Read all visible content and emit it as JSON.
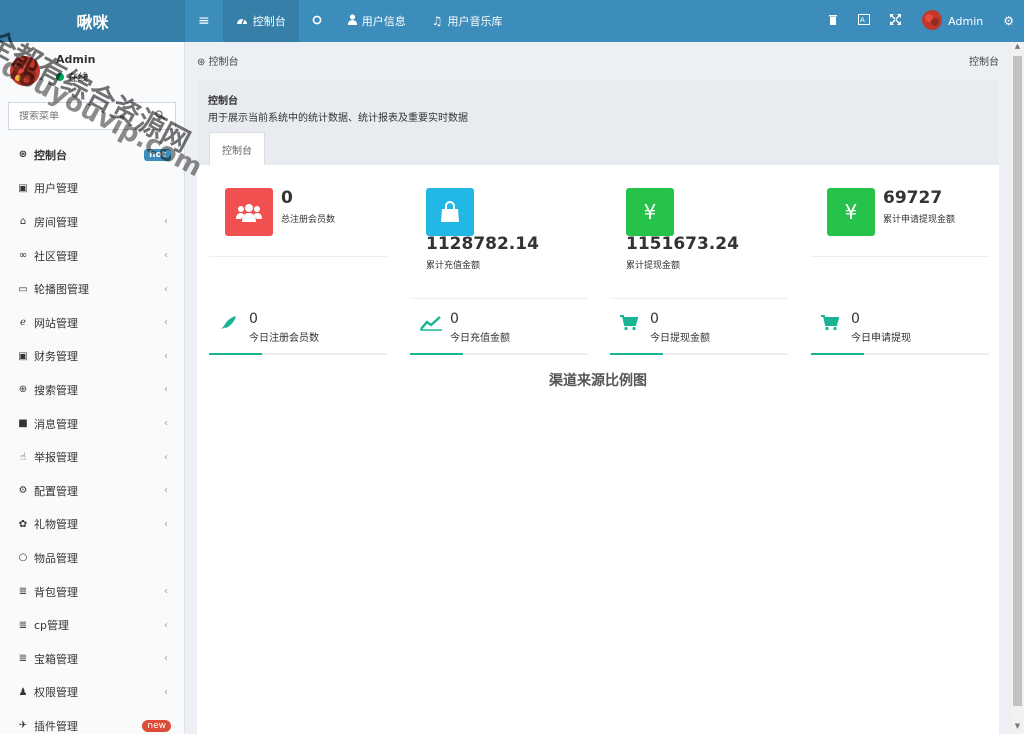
{
  "app": {
    "logo": "啾咪"
  },
  "topnav": {
    "menu_icon": "≡",
    "items": [
      {
        "label": "控制台",
        "icon": "dashboard-icon"
      },
      {
        "label": "",
        "icon": "circle-icon"
      },
      {
        "label": "用户信息",
        "icon": "user-icon"
      },
      {
        "label": "用户音乐库",
        "icon": "music-icon"
      }
    ],
    "right": {
      "admin_name": "Admin"
    }
  },
  "sidebar": {
    "user": {
      "name": "Admin",
      "status": "在线"
    },
    "search_placeholder": "搜索菜单",
    "items": [
      {
        "label": "控制台",
        "icon": "⊛",
        "badge": "hot"
      },
      {
        "label": "用户管理",
        "icon": "▣"
      },
      {
        "label": "房间管理",
        "icon": "⌂"
      },
      {
        "label": "社区管理",
        "icon": "∞"
      },
      {
        "label": "轮播图管理",
        "icon": "▭"
      },
      {
        "label": "网站管理",
        "icon": "ℯ"
      },
      {
        "label": "财务管理",
        "icon": "▣"
      },
      {
        "label": "搜索管理",
        "icon": "⊕"
      },
      {
        "label": "消息管理",
        "icon": "■"
      },
      {
        "label": "举报管理",
        "icon": "☝"
      },
      {
        "label": "配置管理",
        "icon": "⚙"
      },
      {
        "label": "礼物管理",
        "icon": "✿"
      },
      {
        "label": "物品管理",
        "icon": "○"
      },
      {
        "label": "背包管理",
        "icon": "≣"
      },
      {
        "label": "cp管理",
        "icon": "≣"
      },
      {
        "label": "宝箱管理",
        "icon": "≣"
      },
      {
        "label": "权限管理",
        "icon": "♟"
      },
      {
        "label": "插件管理",
        "icon": "✈",
        "badge": "new"
      }
    ]
  },
  "breadcrumb": {
    "left": "控制台",
    "right": "控制台"
  },
  "panel": {
    "title": "控制台",
    "description": "用于展示当前系统中的统计数据、统计报表及重要实时数据",
    "tab": "控制台"
  },
  "stats": [
    {
      "value": "0",
      "label": "总注册会员数",
      "color": "#f05050",
      "icon": "users-icon"
    },
    {
      "value": "1128782.14",
      "label": "累计充值金额",
      "color": "#23b7e5",
      "icon": "bag-icon"
    },
    {
      "value": "1151673.24",
      "label": "累计提现金额",
      "color": "#27c24c",
      "icon": "yen-icon"
    },
    {
      "value": "69727",
      "label": "累计申请提现金额",
      "color": "#27c24c",
      "icon": "yen-icon"
    }
  ],
  "today": [
    {
      "value": "0",
      "label": "今日注册会员数",
      "icon": "rocket-icon"
    },
    {
      "value": "0",
      "label": "今日充值金额",
      "icon": "chart-line-icon"
    },
    {
      "value": "0",
      "label": "今日提现金额",
      "icon": "cart-icon"
    },
    {
      "value": "0",
      "label": "今日申请提现",
      "icon": "cart-icon"
    }
  ],
  "chart_title": "渠道来源比例图",
  "watermark": [
    "全都有综合资源网",
    "douyouvip.com"
  ]
}
